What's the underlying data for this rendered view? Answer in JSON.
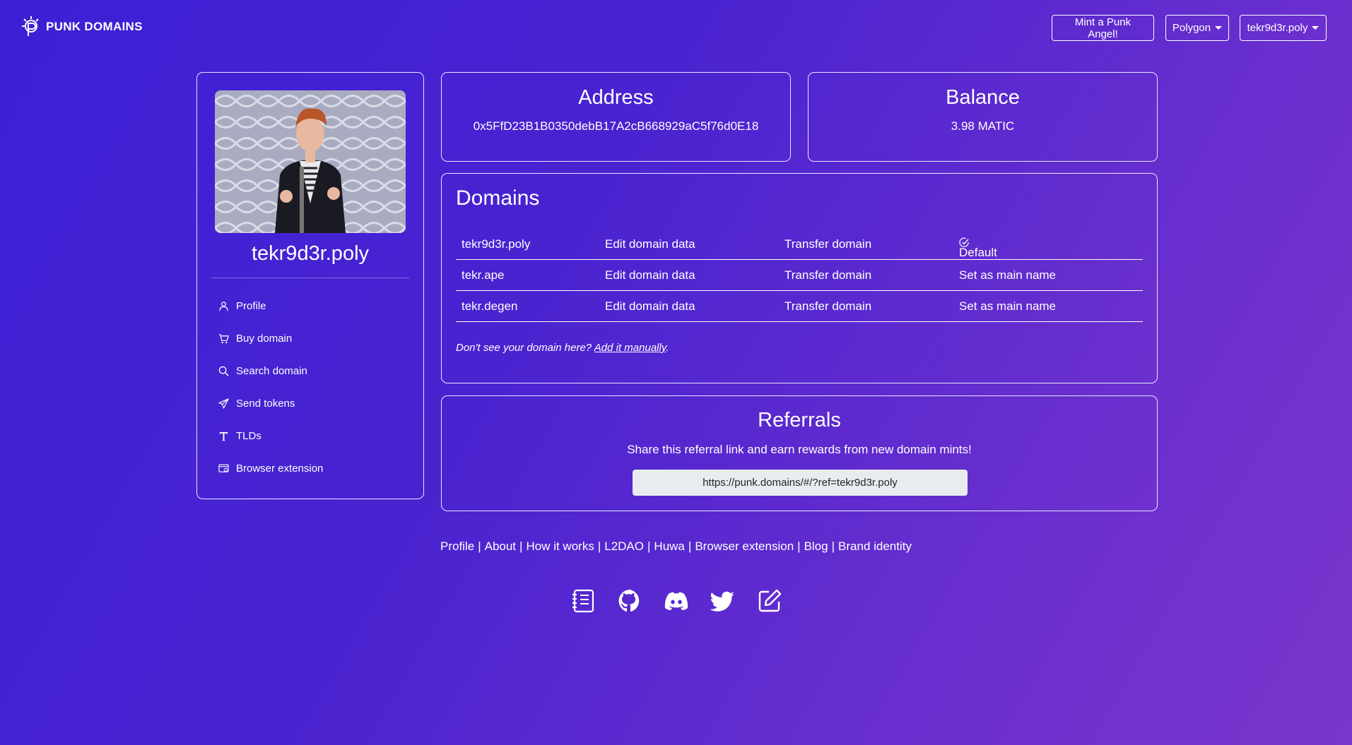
{
  "header": {
    "brand": "PUNK DOMAINS",
    "mint_button": "Mint a Punk Angel!",
    "network_dropdown": "Polygon",
    "account_dropdown": "tekr9d3r.poly"
  },
  "sidebar": {
    "profile_name": "tekr9d3r.poly",
    "items": [
      {
        "label": "Profile",
        "icon": "person-icon"
      },
      {
        "label": "Buy domain",
        "icon": "cart-icon"
      },
      {
        "label": "Search domain",
        "icon": "search-icon"
      },
      {
        "label": "Send tokens",
        "icon": "send-icon"
      },
      {
        "label": "TLDs",
        "icon": "tld-icon"
      },
      {
        "label": "Browser extension",
        "icon": "browser-extension-icon"
      }
    ]
  },
  "address_card": {
    "title": "Address",
    "value": "0x5FfD23B1B0350debB17A2cB668929aC5f76d0E18"
  },
  "balance_card": {
    "title": "Balance",
    "value": "3.98 MATIC"
  },
  "domains_card": {
    "title": "Domains",
    "rows": [
      {
        "name": "tekr9d3r.poly",
        "edit": "Edit domain data",
        "transfer": "Transfer domain",
        "action": "Default"
      },
      {
        "name": "tekr.ape",
        "edit": "Edit domain data",
        "transfer": "Transfer domain",
        "action": "Set as main name"
      },
      {
        "name": "tekr.degen",
        "edit": "Edit domain data",
        "transfer": "Transfer domain",
        "action": "Set as main name"
      }
    ],
    "note_prefix": "Don't see your domain here?",
    "note_link": "Add it manually",
    "note_suffix": "."
  },
  "referrals_card": {
    "title": "Referrals",
    "description": "Share this referral link and earn rewards from new domain mints!",
    "link": "https://punk.domains/#/?ref=tekr9d3r.poly"
  },
  "footer": {
    "links": [
      "Profile",
      "About",
      "How it works",
      "L2DAO",
      "Huwa",
      "Browser extension",
      "Blog",
      "Brand identity"
    ],
    "separator": "|",
    "social_icons": [
      "docs-icon",
      "github-icon",
      "discord-icon",
      "twitter-icon",
      "blog-edit-icon"
    ]
  }
}
